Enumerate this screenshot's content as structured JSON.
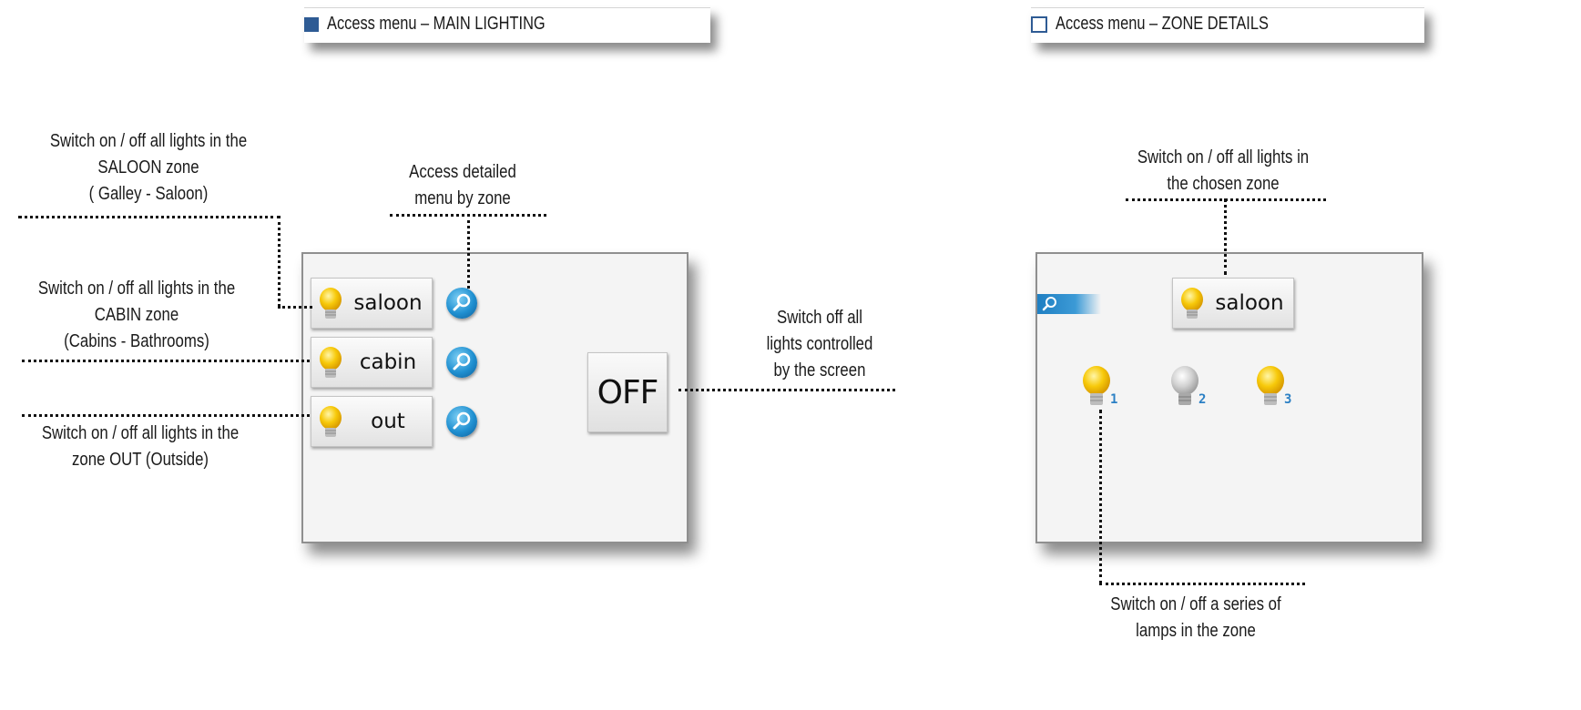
{
  "headers": {
    "main_lighting": "Access menu – MAIN LIGHTING",
    "zone_details": "Access menu –  ZONE DETAILS"
  },
  "annotations": {
    "saloon_zone": [
      "Switch on / off all lights in the",
      "SALOON zone",
      "( Galley - Saloon)"
    ],
    "access_detail": [
      "Access detailed",
      "menu by zone"
    ],
    "cabin_zone": [
      "Switch on / off all lights in the",
      "CABIN zone",
      "(Cabins - Bathrooms)"
    ],
    "out_zone": [
      "Switch on / off all lights in the",
      "zone OUT (Outside)"
    ],
    "switch_off_all": [
      "Switch off all",
      "lights controlled",
      " by the screen"
    ],
    "chosen_zone": [
      "Switch on / off all lights in",
      "the chosen zone"
    ],
    "series_lamps": [
      "Switch on / off a series of",
      "lamps in the zone"
    ]
  },
  "main_screen": {
    "zones": [
      "saloon",
      "cabin",
      "out"
    ],
    "off_label": "OFF"
  },
  "zone_screen": {
    "zone_label": "saloon",
    "lamps": [
      {
        "number": "1",
        "state": "on"
      },
      {
        "number": "2",
        "state": "off"
      },
      {
        "number": "3",
        "state": "on"
      }
    ]
  },
  "colors": {
    "bulb_on": "#f7c90a",
    "bulb_off": "#c9c9c9",
    "accent_blue": "#2e5b94",
    "zoom_blue": "#1f8fd0"
  }
}
